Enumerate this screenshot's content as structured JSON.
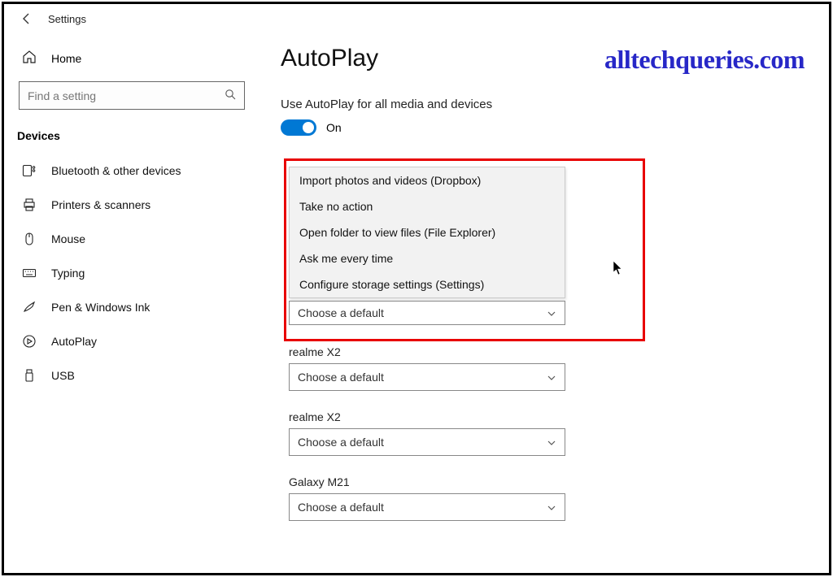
{
  "app": {
    "title": "Settings"
  },
  "brand": "alltechqueries.com",
  "sidebar": {
    "home": "Home",
    "search_placeholder": "Find a setting",
    "section": "Devices",
    "items": [
      {
        "label": "Bluetooth & other devices",
        "icon": "bluetooth-icon"
      },
      {
        "label": "Printers & scanners",
        "icon": "printer-icon"
      },
      {
        "label": "Mouse",
        "icon": "mouse-icon"
      },
      {
        "label": "Typing",
        "icon": "keyboard-icon"
      },
      {
        "label": "Pen & Windows Ink",
        "icon": "pen-icon"
      },
      {
        "label": "AutoPlay",
        "icon": "autoplay-icon"
      },
      {
        "label": "USB",
        "icon": "usb-icon"
      }
    ]
  },
  "page": {
    "title": "AutoPlay",
    "toggle_caption": "Use AutoPlay for all media and devices",
    "toggle_state": "On",
    "toggle_on": true
  },
  "dropdown": {
    "visible_select_text": "Choose a default",
    "options": [
      "Import photos and videos (Dropbox)",
      "Take no action",
      "Open folder to view files (File Explorer)",
      "Ask me every time",
      "Configure storage settings (Settings)"
    ]
  },
  "devices": [
    {
      "name": "realme X2",
      "value": "Choose a default"
    },
    {
      "name": "realme X2",
      "value": "Choose a default"
    },
    {
      "name": "Galaxy M21",
      "value": "Choose a default"
    }
  ]
}
